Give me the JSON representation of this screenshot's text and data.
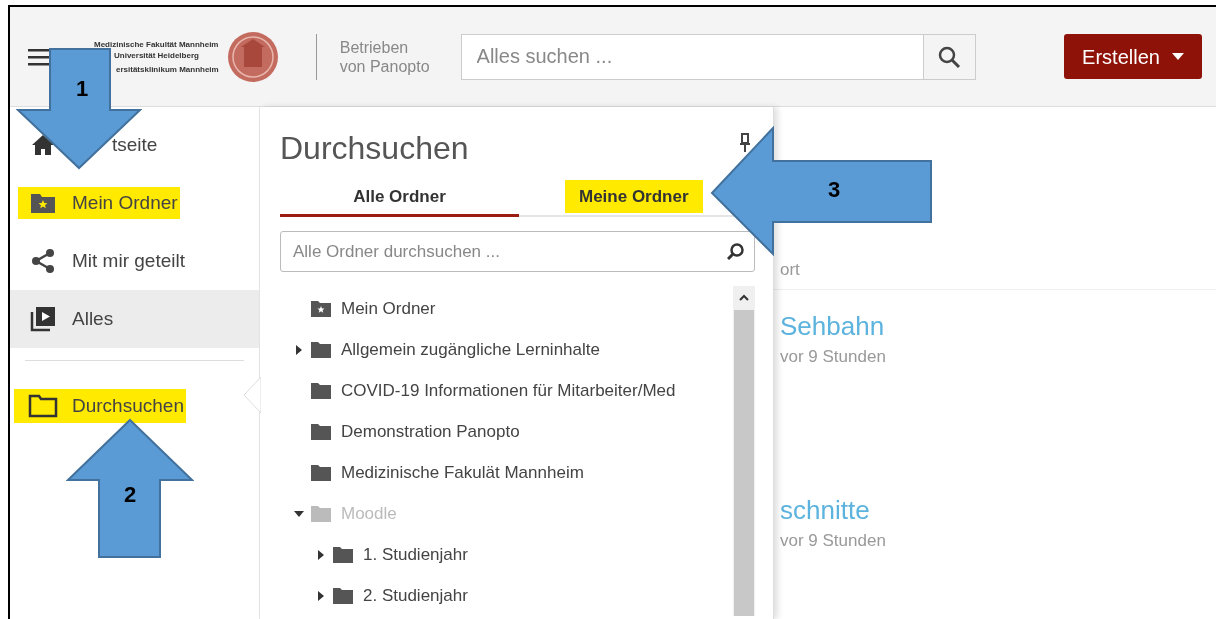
{
  "header": {
    "logo_lines": [
      "Medizinische Fakultät Mannheim",
      "Universität Heidelberg",
      "ersitätsklinikum Mannheim"
    ],
    "powered_by": [
      "Betrieben",
      "von Panopto"
    ],
    "search": {
      "placeholder": "Alles suchen ..."
    },
    "create_button": "Erstellen"
  },
  "sidebar": {
    "items": [
      {
        "label": "tseite",
        "selected": false,
        "highlighted": false
      },
      {
        "label": "Mein Ordner",
        "selected": false,
        "highlighted": true
      },
      {
        "label": "Mit mir geteilt",
        "selected": false,
        "highlighted": false
      },
      {
        "label": "Alles",
        "selected": true,
        "highlighted": false
      }
    ],
    "browse": {
      "label": "Durchsuchen",
      "selected": false,
      "highlighted": true
    }
  },
  "panel": {
    "title": "Durchsuchen",
    "tabs": [
      {
        "label": "Alle Ordner",
        "selected": true,
        "highlighted": false
      },
      {
        "label": "Meine Ordner",
        "selected": false,
        "highlighted": true
      }
    ],
    "search": {
      "placeholder": "Alle Ordner durchsuchen ..."
    },
    "tree": [
      {
        "label": "Mein Ordner",
        "kind": "personal",
        "expandable": false,
        "dimmed": false
      },
      {
        "label": "Allgemein zugängliche Lerninhalte",
        "kind": "folder",
        "expandable": true,
        "expanded": false,
        "dimmed": false
      },
      {
        "label": "COVID-19 Informationen für Mitarbeiter/Med",
        "kind": "folder",
        "expandable": false,
        "dimmed": false
      },
      {
        "label": "Demonstration Panopto",
        "kind": "folder",
        "expandable": false,
        "dimmed": false
      },
      {
        "label": "Medizinische Fakulät Mannheim",
        "kind": "folder",
        "expandable": false,
        "dimmed": false
      },
      {
        "label": "Moodle",
        "kind": "folder",
        "expandable": true,
        "expanded": true,
        "dimmed": true,
        "children": [
          {
            "label": "1. Studienjahr",
            "kind": "folder",
            "expandable": true,
            "expanded": false,
            "dimmed": false
          },
          {
            "label": "2. Studienjahr",
            "kind": "folder",
            "expandable": true,
            "expanded": false,
            "dimmed": false
          }
        ]
      }
    ]
  },
  "background": {
    "sort_label": "ort",
    "sessions": [
      {
        "title": "Sehbahn",
        "time": "vor 9 Stunden"
      },
      {
        "title": "schnitte",
        "time": "vor 9 Stunden"
      }
    ]
  },
  "annotations": [
    {
      "number": "1",
      "kind": "down"
    },
    {
      "number": "2",
      "kind": "up"
    },
    {
      "number": "3",
      "kind": "left"
    }
  ]
}
